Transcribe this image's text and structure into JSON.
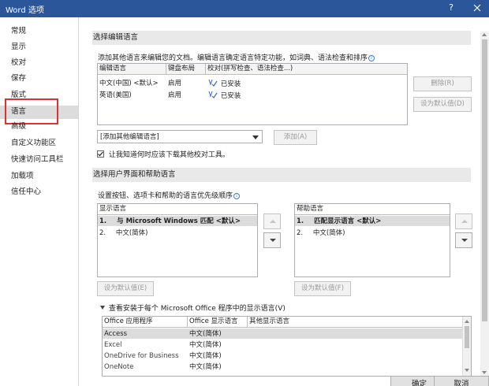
{
  "window": {
    "title": "Word 选项",
    "help_glyph": "?"
  },
  "sidebar": {
    "items": [
      {
        "label": "常规"
      },
      {
        "label": "显示"
      },
      {
        "label": "校对"
      },
      {
        "label": "保存"
      },
      {
        "label": "版式"
      },
      {
        "label": "语言"
      },
      {
        "label": "高级"
      },
      {
        "label": "自定义功能区"
      },
      {
        "label": "快速访问工具栏"
      },
      {
        "label": "加载项"
      },
      {
        "label": "信任中心"
      }
    ]
  },
  "editing": {
    "heading": "选择编辑语言",
    "description": "添加其他语言来编辑您的文档。编辑语言确定语言特定功能，如词典、语法检查和排序",
    "columns": [
      "编辑语言",
      "键盘布局",
      "校对(拼写检查、语法检查...)"
    ],
    "rows": [
      {
        "language": "中文(中国) <默认>",
        "keyboard": "启用",
        "proofing": "已安装"
      },
      {
        "language": "英语(美国)",
        "keyboard": "启用",
        "proofing": "已安装"
      }
    ],
    "remove_label": "删除(R)",
    "set_default_label": "设为默认值(D)",
    "add_dropdown_value": "[添加其他编辑语言]",
    "add_label": "添加(A)",
    "notify_label": "让我知道何时应该下载其他校对工具。",
    "notify_checked": true
  },
  "ui_lang": {
    "heading": "选择用户界面和帮助语言",
    "description": "设置按钮、选项卡和帮助的语言优先级顺序",
    "display": {
      "header": "显示语言",
      "items": [
        {
          "num": "1.",
          "label": "与 Microsoft Windows 匹配 <默认>"
        },
        {
          "num": "2.",
          "label": "中文(简体)"
        }
      ],
      "set_default_label": "设为默认值(E)"
    },
    "help": {
      "header": "帮助语言",
      "items": [
        {
          "num": "1.",
          "label": "匹配显示语言 <默认>"
        },
        {
          "num": "2.",
          "label": "中文(简体)"
        }
      ],
      "set_default_label": "设为默认值(F)"
    },
    "expand_label": "查看安装于每个 Microsoft Office 程序中的显示语言(V)",
    "apps": {
      "columns": [
        "Office 应用程序",
        "Office 显示语言",
        "其他显示语言"
      ],
      "rows": [
        {
          "app": "Access",
          "lang": "中文(简体)",
          "other": ""
        },
        {
          "app": "Excel",
          "lang": "中文(简体)",
          "other": ""
        },
        {
          "app": "OneDrive for Business",
          "lang": "中文(简体)",
          "other": ""
        },
        {
          "app": "OneNote",
          "lang": "中文(简体)",
          "other": ""
        }
      ]
    }
  },
  "footer": {
    "ok_label": "确定",
    "cancel_label": "取消"
  },
  "colors": {
    "titlebar": "#2b579a",
    "highlight": "#e03030"
  }
}
